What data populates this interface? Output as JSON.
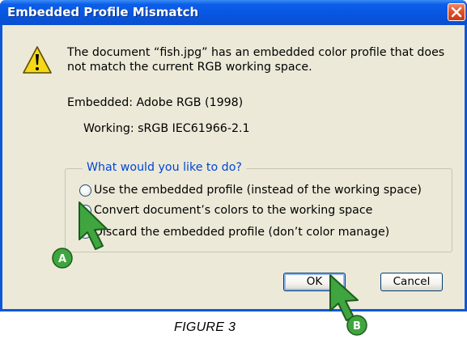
{
  "window": {
    "title": "Embedded Profile Mismatch",
    "close_icon": "close-icon"
  },
  "message": {
    "icon": "warning-icon",
    "text": "The document “fish.jpg” has an embedded color profile that does not match the current RGB working space."
  },
  "profiles": {
    "embedded": "Embedded:  Adobe RGB (1998)",
    "working": "Working:  sRGB IEC61966-2.1"
  },
  "options": {
    "legend": "What would you like to do?",
    "items": [
      {
        "label": "Use the embedded profile (instead of the working space)",
        "selected": false
      },
      {
        "label": "Convert document’s colors to the working space",
        "selected": true
      },
      {
        "label": "Discard the embedded profile (don’t color manage)",
        "selected": false
      }
    ]
  },
  "buttons": {
    "ok": "OK",
    "cancel": "Cancel"
  },
  "annotations": {
    "a": "A",
    "b": "B"
  },
  "caption": "FIGURE 3",
  "colors": {
    "titlebar": "#0755e0",
    "dialog_bg": "#ece9d8",
    "legend_text": "#0046d5",
    "pointer_green": "#3fa53f"
  }
}
